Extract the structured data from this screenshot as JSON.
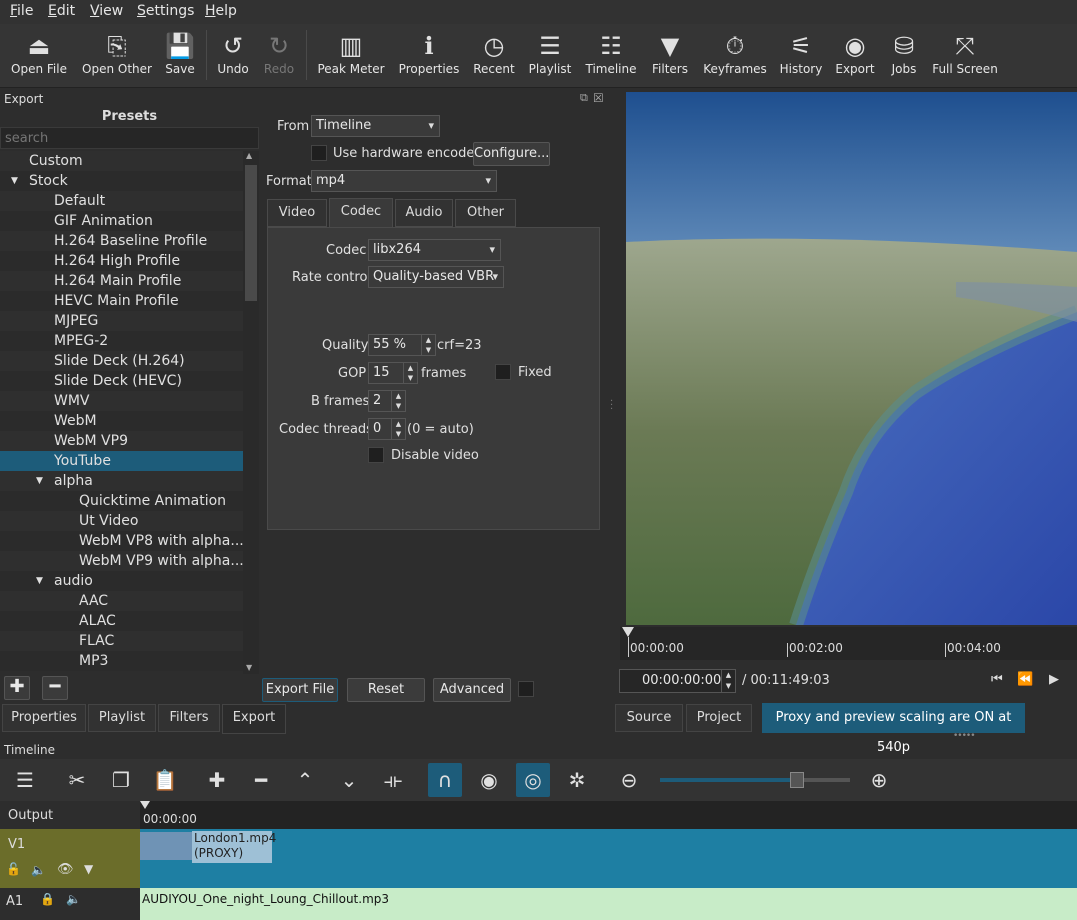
{
  "menu": [
    "File",
    "Edit",
    "View",
    "Settings",
    "Help"
  ],
  "toolbar": {
    "open_file": "Open File",
    "open_other": "Open Other",
    "save": "Save",
    "undo": "Undo",
    "redo": "Redo",
    "peak_meter": "Peak Meter",
    "properties": "Properties",
    "recent": "Recent",
    "playlist": "Playlist",
    "timeline": "Timeline",
    "filters": "Filters",
    "keyframes": "Keyframes",
    "history": "History",
    "export": "Export",
    "jobs": "Jobs",
    "full_screen": "Full Screen"
  },
  "export_panel": {
    "title": "Export",
    "presets_title": "Presets",
    "search_placeholder": "search",
    "presets": [
      {
        "label": "Custom",
        "indent": 1,
        "arrow": ""
      },
      {
        "label": "Stock",
        "indent": 1,
        "arrow": "down"
      },
      {
        "label": "Default",
        "indent": 2,
        "arrow": ""
      },
      {
        "label": "GIF Animation",
        "indent": 2,
        "arrow": ""
      },
      {
        "label": "H.264 Baseline Profile",
        "indent": 2,
        "arrow": ""
      },
      {
        "label": "H.264 High Profile",
        "indent": 2,
        "arrow": ""
      },
      {
        "label": "H.264 Main Profile",
        "indent": 2,
        "arrow": ""
      },
      {
        "label": "HEVC Main Profile",
        "indent": 2,
        "arrow": ""
      },
      {
        "label": "MJPEG",
        "indent": 2,
        "arrow": ""
      },
      {
        "label": "MPEG-2",
        "indent": 2,
        "arrow": ""
      },
      {
        "label": "Slide Deck (H.264)",
        "indent": 2,
        "arrow": ""
      },
      {
        "label": "Slide Deck (HEVC)",
        "indent": 2,
        "arrow": ""
      },
      {
        "label": "WMV",
        "indent": 2,
        "arrow": ""
      },
      {
        "label": "WebM",
        "indent": 2,
        "arrow": ""
      },
      {
        "label": "WebM VP9",
        "indent": 2,
        "arrow": ""
      },
      {
        "label": "YouTube",
        "indent": 2,
        "arrow": "",
        "selected": true
      },
      {
        "label": "alpha",
        "indent": 2,
        "arrow": "down"
      },
      {
        "label": "Quicktime Animation",
        "indent": 3,
        "arrow": ""
      },
      {
        "label": "Ut Video",
        "indent": 3,
        "arrow": ""
      },
      {
        "label": "WebM VP8 with alpha...",
        "indent": 3,
        "arrow": ""
      },
      {
        "label": "WebM VP9 with alpha...",
        "indent": 3,
        "arrow": ""
      },
      {
        "label": "audio",
        "indent": 2,
        "arrow": "down"
      },
      {
        "label": "AAC",
        "indent": 3,
        "arrow": ""
      },
      {
        "label": "ALAC",
        "indent": 3,
        "arrow": ""
      },
      {
        "label": "FLAC",
        "indent": 3,
        "arrow": ""
      },
      {
        "label": "MP3",
        "indent": 3,
        "arrow": ""
      }
    ],
    "from_label": "From",
    "from_value": "Timeline",
    "hw_encoder_label": "Use hardware encoder",
    "configure": "Configure...",
    "format_label": "Format",
    "format_value": "mp4",
    "tabs": [
      "Video",
      "Codec",
      "Audio",
      "Other"
    ],
    "active_tab": "Codec",
    "codec_label": "Codec",
    "codec_value": "libx264",
    "rate_control_label": "Rate control",
    "rate_control_value": "Quality-based VBR",
    "quality_label": "Quality",
    "quality_value": "55 %",
    "quality_note": "crf=23",
    "gop_label": "GOP",
    "gop_value": "15",
    "gop_unit": "frames",
    "fixed_label": "Fixed",
    "bframes_label": "B frames",
    "bframes_value": "2",
    "threads_label": "Codec threads",
    "threads_value": "0",
    "threads_note": "(0 = auto)",
    "disable_video_label": "Disable video",
    "export_file": "Export File",
    "reset": "Reset",
    "advanced": "Advanced"
  },
  "bottom_tabs": [
    "Properties",
    "Playlist",
    "Filters",
    "Export"
  ],
  "player": {
    "ruler": [
      "00:00:00",
      "00:02:00",
      "00:04:00"
    ],
    "position": "00:00:00:00",
    "duration": "/ 00:11:49:03",
    "source_tab": "Source",
    "project_tab": "Project",
    "proxy_notice": "Proxy and preview scaling are ON at 540p"
  },
  "timeline": {
    "title": "Timeline",
    "output_label": "Output",
    "ruler_time": "00:00:00",
    "v1_label": "V1",
    "a1_label": "A1",
    "video_clip_name": "London1.mp4",
    "video_clip_proxy": "(PROXY)",
    "audio_clip_name": "AUDIYOU_One_night_Loung_Chillout.mp3",
    "zoom_level": 0.72
  },
  "colors": {
    "accent": "#1d5c7a",
    "v1_track": "#6b6d2a",
    "video_clip": "#1e7fa3",
    "audio_clip": "#c8ecc8"
  }
}
